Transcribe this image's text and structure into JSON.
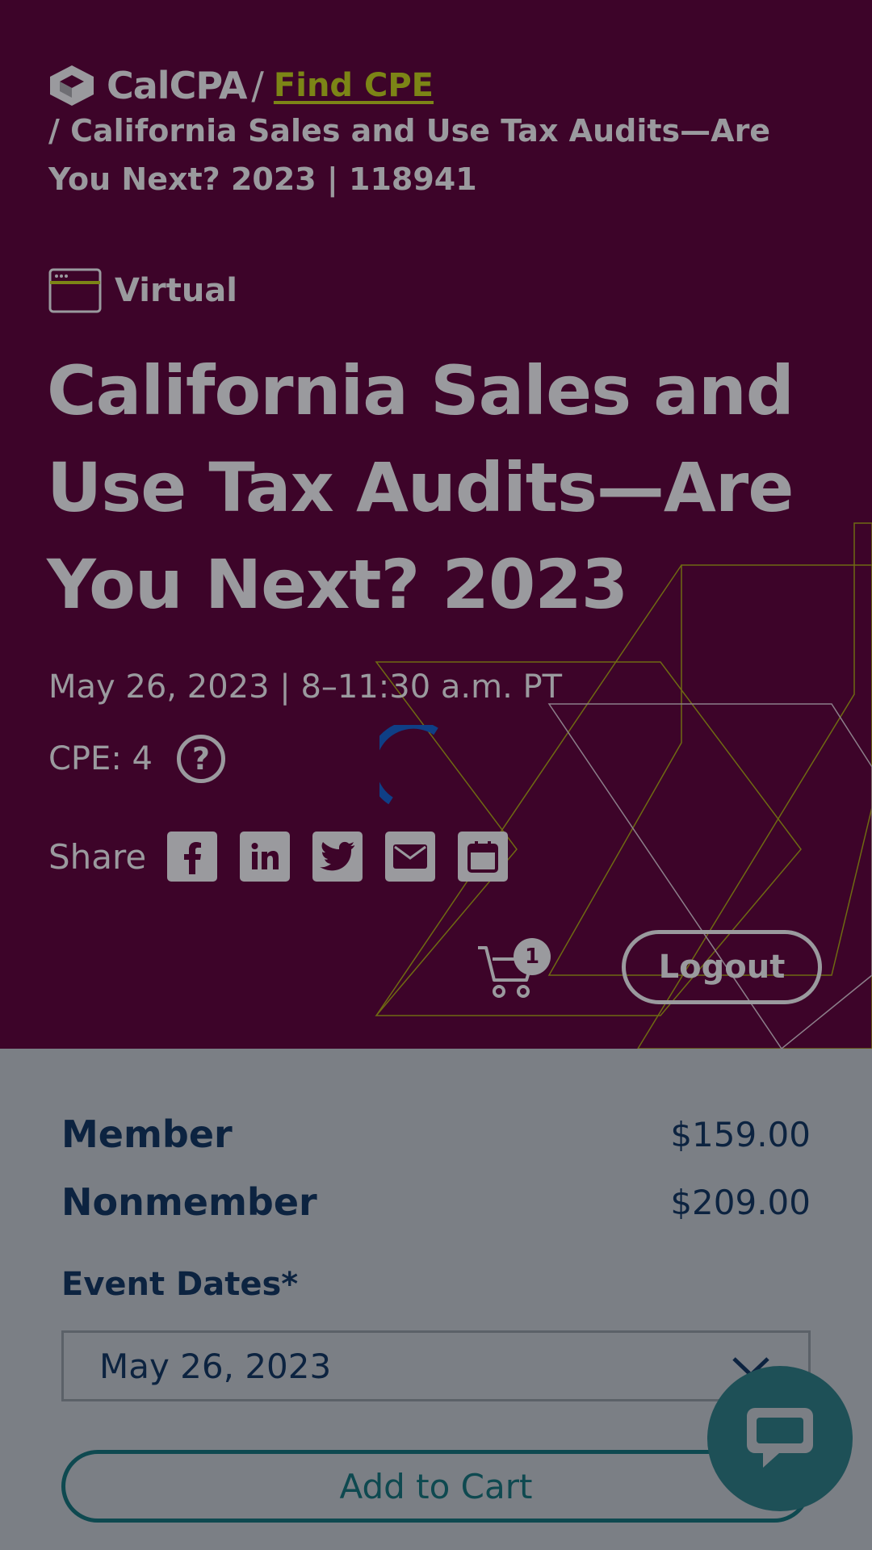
{
  "header": {
    "brand": "CalCPA",
    "separator": "/",
    "find_link": "Find CPE",
    "breadcrumb": "/ California Sales and Use Tax Audits—Are You Next? 2023 | 118941"
  },
  "event": {
    "format": "Virtual",
    "title": "California Sales and Use Tax Audits—Are You Next? 2023",
    "datetime": "May 26, 2023 | 8–11:30 a.m. PT",
    "cpe": "CPE: 4",
    "help_glyph": "?"
  },
  "share": {
    "label": "Share",
    "icons": [
      "facebook-icon",
      "linkedin-icon",
      "twitter-icon",
      "email-icon",
      "calendar-icon"
    ]
  },
  "cart": {
    "count": "1"
  },
  "account": {
    "logout_label": "Logout"
  },
  "pricing": [
    {
      "label": "Member",
      "price": "$159.00"
    },
    {
      "label": "Nonmember",
      "price": "$209.00"
    }
  ],
  "registration": {
    "dates_label": "Event Dates*",
    "selected_date": "May 26, 2023",
    "add_to_cart_label": "Add to Cart"
  },
  "colors": {
    "hero_bg": "#3d0429",
    "overlay_text": "#9a9a9e",
    "link_olive": "#7c8516",
    "panel_bg": "#7b7f85",
    "navy": "#0c2340",
    "teal": "#0e4950",
    "spinner_blue": "#0f3f86"
  }
}
